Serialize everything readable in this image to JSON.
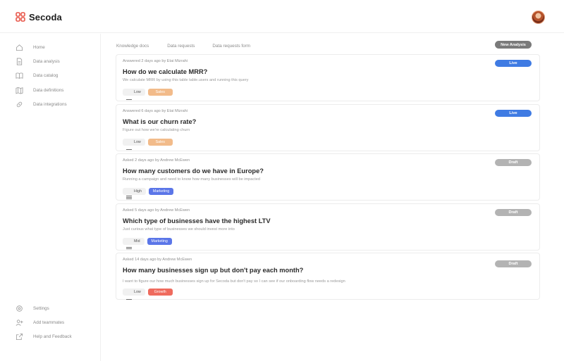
{
  "app": {
    "name": "Secoda",
    "brand_color": "#e8574a"
  },
  "sidebar": {
    "top_items": [
      {
        "label": "Home",
        "icon": "home-icon"
      },
      {
        "label": "Data analysis",
        "icon": "document-icon"
      },
      {
        "label": "Data catalog",
        "icon": "book-icon"
      },
      {
        "label": "Data definitions",
        "icon": "map-icon"
      },
      {
        "label": "Data integrations",
        "icon": "link-icon"
      }
    ],
    "bottom_items": [
      {
        "label": "Settings",
        "icon": "gear-icon"
      },
      {
        "label": "Add teammates",
        "icon": "user-add-icon"
      },
      {
        "label": "Help and Feedback",
        "icon": "external-link-icon"
      }
    ]
  },
  "tabs": [
    {
      "label": "Knowledge docs"
    },
    {
      "label": "Data requests"
    },
    {
      "label": "Data requests form"
    }
  ],
  "new_analysis_label": "New Analysis",
  "cards": [
    {
      "meta": "Answered 2 days ago by Etai Mizrahi",
      "title": "How do we calculate MRR?",
      "description": "We calculate MRR by using this table table.users and running this query",
      "priority": "Low",
      "team": "Sales",
      "team_color": "#f2bb8a",
      "status": "Live",
      "status_color": "#3f7be3"
    },
    {
      "meta": "Answered 6 days ago by Etai Mizrahi",
      "title": "What is our churn rate?",
      "description": "Figure out how we're calculating churn",
      "priority": "Low",
      "team": "Sales",
      "team_color": "#f2bb8a",
      "status": "Live",
      "status_color": "#3f7be3"
    },
    {
      "meta": "Asked 2 days ago by Andrew McEwen",
      "title": "How many customers do we have in Europe?",
      "description": "Running a campaign and need to know how many businesses will be impacted",
      "priority": "High",
      "team": "Marketing",
      "team_color": "#5b76e8",
      "status": "Draft",
      "status_color": "#b3b3b3"
    },
    {
      "meta": "Asked 5 days ago by Andrew McEwen",
      "title": "Which type of businesses have the highest LTV",
      "description": "Just curious what type of businesses we should invest more into",
      "priority": "Mid",
      "team": "Marketing",
      "team_color": "#5b76e8",
      "status": "Draft",
      "status_color": "#b3b3b3"
    },
    {
      "meta": "Asked 14 days ago by Andrew McEwen",
      "title": "How many businesses sign up but don't pay each month?",
      "description": "I want to figure our how much businesses sign up for Secoda but don't pay so I can see if our onboarding flow needs a redesign",
      "priority": "Low",
      "team": "Growth",
      "team_color": "#ef6b5e",
      "status": "Draft",
      "status_color": "#b3b3b3"
    }
  ]
}
